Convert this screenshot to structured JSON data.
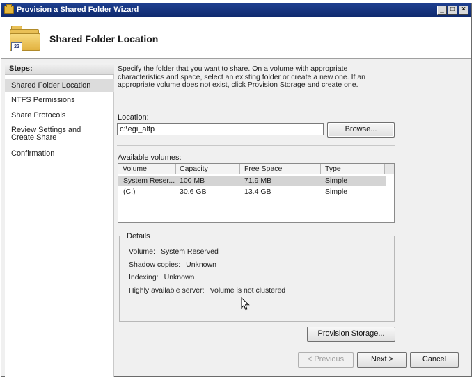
{
  "window": {
    "title": "Provision a Shared Folder Wizard"
  },
  "header": {
    "title": "Shared Folder Location",
    "icon": "folder-icon",
    "badge": "22"
  },
  "steps": {
    "title": "Steps:",
    "items": [
      {
        "label": "Shared Folder Location",
        "active": true
      },
      {
        "label": "NTFS Permissions"
      },
      {
        "label": "Share Protocols"
      },
      {
        "label": "Review Settings and Create Share"
      },
      {
        "label": "Confirmation"
      }
    ]
  },
  "intro": "Specify the folder that you want to share. On a volume with appropriate characteristics and space, select an existing folder or create a new one. If an appropriate volume does not exist, click Provision Storage and create one.",
  "location": {
    "label": "Location:",
    "value": "c:\\egi_altp",
    "browse_label": "Browse..."
  },
  "volumes": {
    "label": "Available volumes:",
    "columns": [
      "Volume",
      "Capacity",
      "Free Space",
      "Type"
    ],
    "rows": [
      {
        "volume": "System Reser...",
        "capacity": "100 MB",
        "free": "71.9 MB",
        "type": "Simple",
        "selected": true
      },
      {
        "volume": "(C:)",
        "capacity": "30.6 GB",
        "free": "13.4 GB",
        "type": "Simple"
      }
    ]
  },
  "details": {
    "title": "Details",
    "volume_label": "Volume:",
    "volume_value": "System Reserved",
    "shadow_label": "Shadow copies:",
    "shadow_value": "Unknown",
    "indexing_label": "Indexing:",
    "indexing_value": "Unknown",
    "ha_label": "Highly available server:",
    "ha_value": "Volume is not clustered"
  },
  "buttons": {
    "provision": "Provision Storage...",
    "previous": "< Previous",
    "next": "Next >",
    "cancel": "Cancel"
  }
}
